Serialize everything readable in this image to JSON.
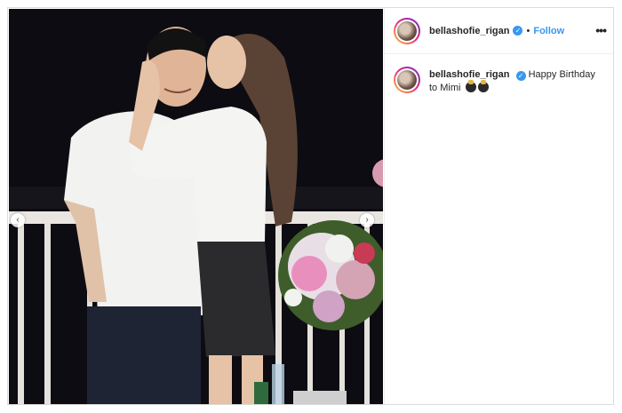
{
  "post": {
    "username": "bellashofie_rigan",
    "follow_label": "Follow",
    "dot": "•",
    "more_label": "•••",
    "caption_text": "Happy Birthday to Mimi",
    "nav_prev": "‹",
    "nav_next": "›"
  },
  "icons": {
    "verified": "verified-badge-icon",
    "avatar": "profile-avatar",
    "emoji": "party-emoji-icon"
  },
  "colors": {
    "link": "#3897f0",
    "text": "#262626",
    "border": "#dbdbdb"
  }
}
